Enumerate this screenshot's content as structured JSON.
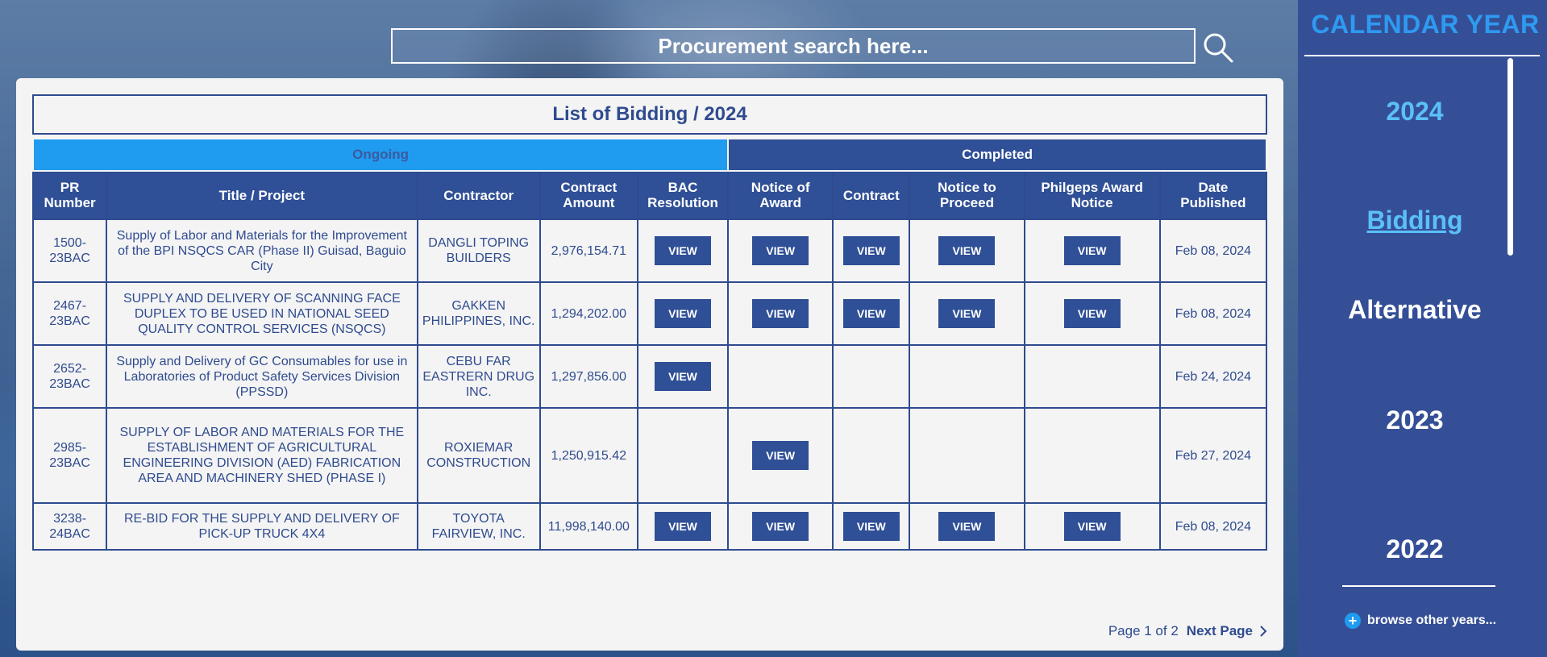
{
  "search": {
    "placeholder": "Procurement search here..."
  },
  "table_title": "List of Bidding / 2024",
  "groups": {
    "ongoing": "Ongoing",
    "completed": "Completed"
  },
  "columns": [
    "PR Number",
    "Title / Project",
    "Contractor",
    "Contract Amount",
    "BAC Resolution",
    "Notice of Award",
    "Contract",
    "Notice to Proceed",
    "Philgeps Award Notice",
    "Date Published"
  ],
  "view_label": "VIEW",
  "rows": [
    {
      "pr": "1500-23BAC",
      "title": "Supply of Labor and Materials for the Improvement of the BPI NSQCS CAR (Phase II) Guisad, Baguio City",
      "contractor": "DANGLI TOPING BUILDERS",
      "amount": "2,976,154.71",
      "bac": true,
      "award": true,
      "contract": true,
      "ntp": true,
      "philgeps": true,
      "date": "Feb 08, 2024"
    },
    {
      "pr": "2467-23BAC",
      "title": "SUPPLY AND DELIVERY OF SCANNING FACE DUPLEX TO BE USED IN NATIONAL SEED QUALITY CONTROL SERVICES (NSQCS)",
      "contractor": "GAKKEN PHILIPPINES, INC.",
      "amount": "1,294,202.00",
      "bac": true,
      "award": true,
      "contract": true,
      "ntp": true,
      "philgeps": true,
      "date": "Feb 08, 2024"
    },
    {
      "pr": "2652-23BAC",
      "title": "Supply and Delivery of GC Consumables for use in Laboratories of Product Safety Services Division (PPSSD)",
      "contractor": "CEBU FAR EASTRERN DRUG INC.",
      "amount": "1,297,856.00",
      "bac": true,
      "award": false,
      "contract": false,
      "ntp": false,
      "philgeps": false,
      "date": "Feb 24, 2024"
    },
    {
      "pr": "2985-23BAC",
      "title": "SUPPLY OF LABOR AND MATERIALS FOR THE ESTABLISHMENT OF AGRICULTURAL ENGINEERING DIVISION (AED) FABRICATION AREA AND MACHINERY SHED (PHASE I)",
      "contractor": "ROXIEMAR CONSTRUCTION",
      "amount": "1,250,915.42",
      "bac": false,
      "award": true,
      "contract": false,
      "ntp": false,
      "philgeps": false,
      "date": "Feb 27, 2024"
    },
    {
      "pr": "3238-24BAC",
      "title": "RE-BID FOR THE SUPPLY AND DELIVERY OF PICK-UP TRUCK 4X4",
      "contractor": "TOYOTA FAIRVIEW, INC.",
      "amount": "11,998,140.00",
      "bac": true,
      "award": true,
      "contract": true,
      "ntp": true,
      "philgeps": true,
      "date": "Feb 08, 2024"
    }
  ],
  "pager": {
    "info": "Page 1 of 2",
    "next": "Next Page"
  },
  "sidebar": {
    "title": "CALENDAR YEAR",
    "items": [
      {
        "label": "2024",
        "color": "#5bc0f8",
        "underline": false
      },
      {
        "label": "Bidding",
        "color": "#5bc0f8",
        "underline": true
      },
      {
        "label": "Alternative",
        "color": "#ffffff",
        "underline": false
      },
      {
        "label": "2023",
        "color": "#ffffff",
        "underline": false
      },
      {
        "label": "2022",
        "color": "#ffffff",
        "underline": false
      }
    ],
    "browse": "browse other years..."
  },
  "colors": {
    "primary": "#2f4f96",
    "accent": "#1f9cf0",
    "panel": "#f4f4f4"
  }
}
